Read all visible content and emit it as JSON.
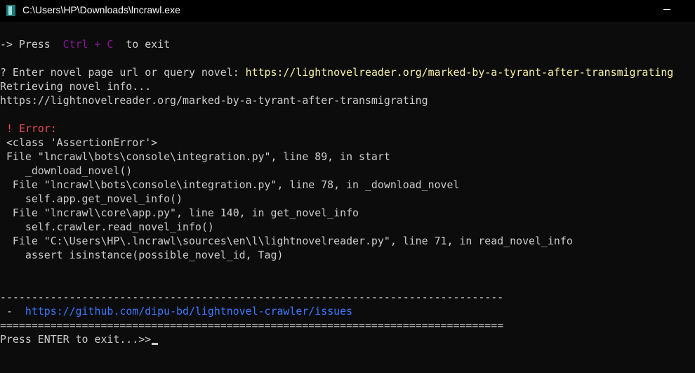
{
  "window": {
    "title": "C:\\Users\\HP\\Downloads\\lncrawl.exe"
  },
  "console": {
    "exit_hint": {
      "prefix": "-> Press ",
      "keys": "Ctrl + C",
      "suffix": " to exit"
    },
    "prompt": {
      "label": "? Enter novel page url or query novel: ",
      "value": "https://lightnovelreader.org/marked-by-a-tyrant-after-transmigrating"
    },
    "retrieving": "Retrieving novel info...",
    "novel_url": "https://lightnovelreader.org/marked-by-a-tyrant-after-transmigrating",
    "error": {
      "heading": " ! Error:",
      "class_line": " <class 'AssertionError'>",
      "trace": [
        " File \"lncrawl\\bots\\console\\integration.py\", line 89, in start",
        "    _download_novel()",
        "  File \"lncrawl\\bots\\console\\integration.py\", line 78, in _download_novel",
        "    self.app.get_novel_info()",
        "  File \"lncrawl\\core\\app.py\", line 140, in get_novel_info",
        "    self.crawler.read_novel_info()",
        "  File \"C:\\Users\\HP\\.lncrawl\\sources\\en\\l\\lightnovelreader.py\", line 71, in read_novel_info",
        "    assert isinstance(possible_novel_id, Tag)"
      ]
    },
    "dash_separator": "--------------------------------------------------------------------------------",
    "issue_prefix": " -  ",
    "issue_link": "https://github.com/dipu-bd/lightnovel-crawler/issues",
    "equals_separator": "================================================================================",
    "exit_prompt": "Press ENTER to exit...>>"
  },
  "colors": {
    "background": "#0c0c0c",
    "text": "#cccccc",
    "yellow": "#f9f1a5",
    "magenta": "#881798",
    "red": "#e74856",
    "blue": "#3b78ff"
  }
}
